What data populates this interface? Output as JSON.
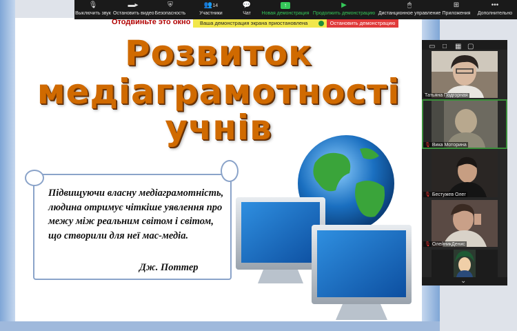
{
  "toolbar": {
    "items": [
      {
        "label": "Выключить звук",
        "icon": "mic-icon"
      },
      {
        "label": "Остановить видео",
        "icon": "video-icon"
      },
      {
        "label": "Безопасность",
        "icon": "shield-icon"
      },
      {
        "label": "Участники",
        "icon": "participants-icon",
        "count": "14"
      },
      {
        "label": "Чат",
        "icon": "chat-icon"
      },
      {
        "label": "Новая демонстрация",
        "icon": "share-icon"
      },
      {
        "label": "Продолжить демонстрацию",
        "icon": "play-icon"
      },
      {
        "label": "Дистанционное управление",
        "icon": "remote-icon"
      },
      {
        "label": "Приложения",
        "icon": "apps-icon"
      },
      {
        "label": "Дополнительно",
        "icon": "more-icon"
      }
    ],
    "accent": "#35c759"
  },
  "share_bar": {
    "status": "Ваша демонстрация экрана приостановлена",
    "stop_label": "Остановить демонстрацию"
  },
  "slide": {
    "obscured_text": "Отодвиньте это окно с",
    "title_line1": "Розвиток",
    "title_line2": "медіаграмотності",
    "title_line3": "учнів",
    "quote": "Підвищуючи власну медіаграмотність, людина отримує чіткіше уявлення про межу між реальним світом і світом, що створили для неї мас-медіа.",
    "author": "Дж. Поттер",
    "title_color": "#d06a00"
  },
  "participants": [
    {
      "name": "Татьяна Подгорная",
      "muted": false
    },
    {
      "name": "Вика Моторина",
      "muted": true
    },
    {
      "name": "Бестужев Олег",
      "muted": true
    },
    {
      "name": "ОлейникДенис",
      "muted": true
    },
    {
      "name": "",
      "muted": false
    }
  ]
}
